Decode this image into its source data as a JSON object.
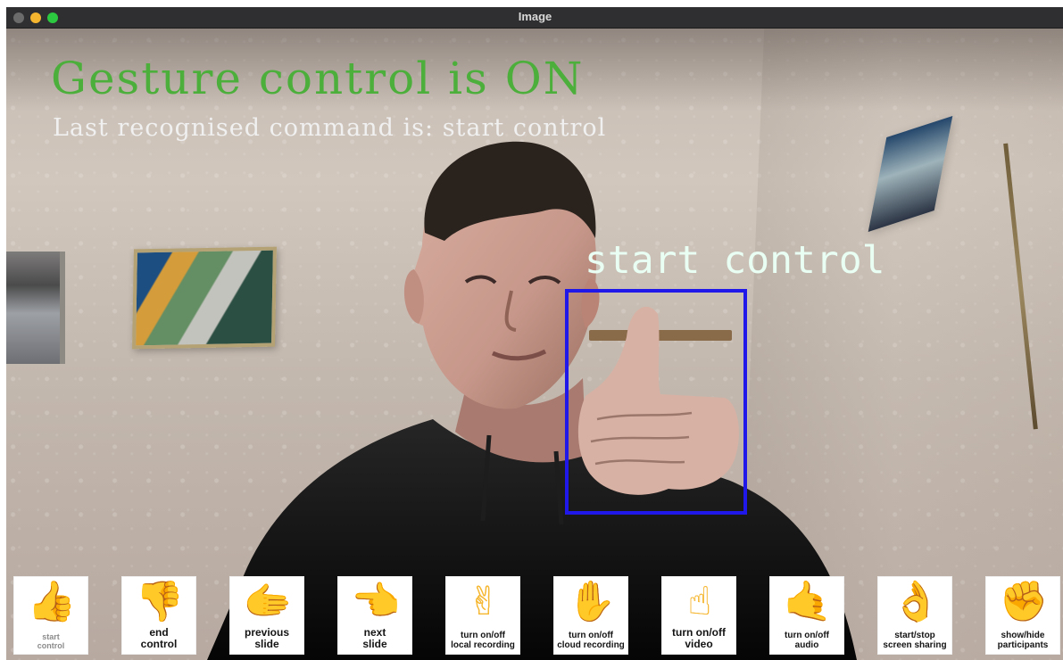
{
  "window": {
    "title": "Image",
    "controls": [
      "close-button",
      "minimize-button",
      "zoom-button"
    ]
  },
  "overlay": {
    "status": "Gesture control is ON",
    "last_command": "Last recognised command is: start control",
    "detected_label": "start control",
    "colors": {
      "status": "#4caf3c",
      "text": "#f0f0f0",
      "detection_box": "#2018e8"
    }
  },
  "gestures": [
    {
      "label": "start\ncontrol",
      "icon": "thumbs-up-icon"
    },
    {
      "label": "end\ncontrol",
      "icon": "thumbs-down-icon"
    },
    {
      "label": "previous\nslide",
      "icon": "pointing-left-hand-icon"
    },
    {
      "label": "next\nslide",
      "icon": "pointing-left-icon"
    },
    {
      "label": "turn on/off\nlocal recording",
      "icon": "victory-hand-icon"
    },
    {
      "label": "turn on/off\ncloud recording",
      "icon": "raised-hand-icon"
    },
    {
      "label": "turn on/off\nvideo",
      "icon": "pointing-up-icon"
    },
    {
      "label": "turn on/off\naudio",
      "icon": "call-me-hand-icon"
    },
    {
      "label": "start/stop\nscreen sharing",
      "icon": "ok-hand-icon"
    },
    {
      "label": "show/hide\nparticipants",
      "icon": "raised-fist-icon"
    }
  ]
}
